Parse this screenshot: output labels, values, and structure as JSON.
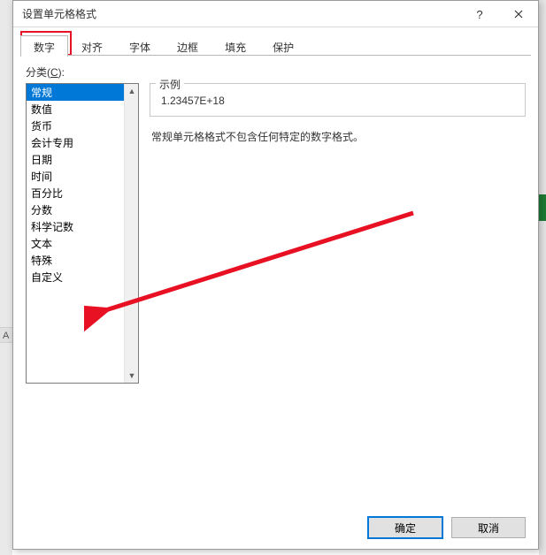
{
  "titlebar": {
    "title": "设置单元格格式",
    "help": "?",
    "close": "×"
  },
  "tabs": {
    "items": [
      {
        "label": "数字",
        "active": true
      },
      {
        "label": "对齐",
        "active": false
      },
      {
        "label": "字体",
        "active": false
      },
      {
        "label": "边框",
        "active": false
      },
      {
        "label": "填充",
        "active": false
      },
      {
        "label": "保护",
        "active": false
      }
    ]
  },
  "category": {
    "label_prefix": "分类(",
    "label_key": "C",
    "label_suffix": "):",
    "items": [
      "常规",
      "数值",
      "货币",
      "会计专用",
      "日期",
      "时间",
      "百分比",
      "分数",
      "科学记数",
      "文本",
      "特殊",
      "自定义"
    ],
    "selected_index": 0
  },
  "sample": {
    "legend": "示例",
    "value": "1.23457E+18"
  },
  "description": "常规单元格格式不包含任何特定的数字格式。",
  "buttons": {
    "ok": "确定",
    "cancel": "取消"
  },
  "colors": {
    "highlight": "#e81123",
    "selection": "#0078d7"
  }
}
